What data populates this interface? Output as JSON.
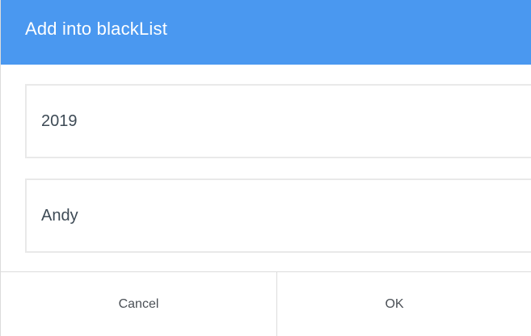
{
  "dialog": {
    "title": "Add into blackList",
    "header_color": "#4a98f0"
  },
  "fields": {
    "number": {
      "value": "2019"
    },
    "name": {
      "value": "Andy"
    }
  },
  "buttons": {
    "cancel_label": "Cancel",
    "ok_label": "OK"
  }
}
